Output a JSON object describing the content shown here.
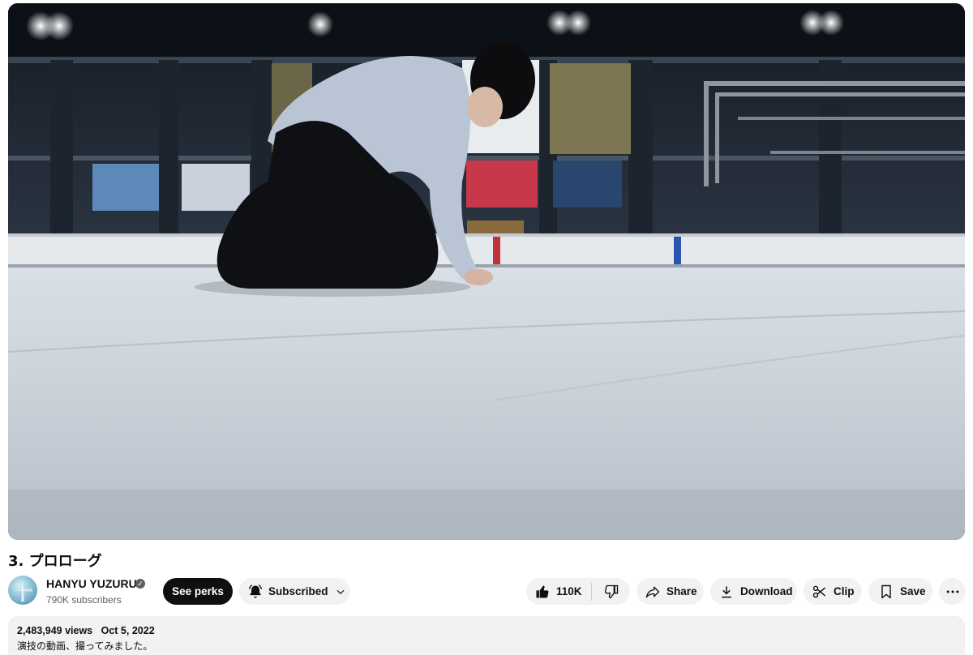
{
  "video": {
    "title": "3. プロローグ"
  },
  "channel": {
    "name": "HANYU YUZURU",
    "subscribers": "790K subscribers",
    "verified_icon": "verified-check-icon"
  },
  "buttons": {
    "perks": "See perks",
    "subscribed": "Subscribed",
    "like_count": "110K",
    "share": "Share",
    "download": "Download",
    "clip": "Clip",
    "save": "Save"
  },
  "description": {
    "views": "2,483,949 views",
    "date": "Oct 5, 2022",
    "text": "演技の動画、撮ってみました。"
  },
  "colors": {
    "accent_dark": "#0f0f0f",
    "pill_bg": "#f2f2f2",
    "muted_text": "#606060"
  },
  "icons": [
    "bell-icon",
    "chevron-down-icon",
    "thumbs-up-icon",
    "thumbs-down-icon",
    "share-arrow-icon",
    "download-icon",
    "scissors-icon",
    "bookmark-icon",
    "more-vert-icon"
  ]
}
